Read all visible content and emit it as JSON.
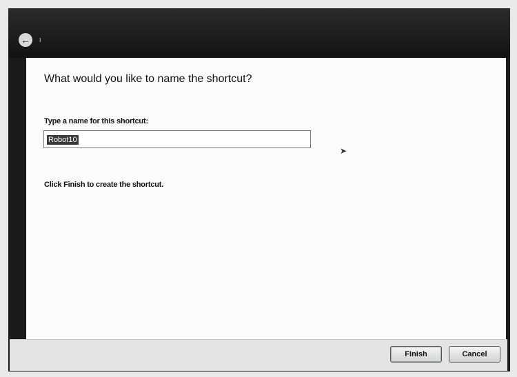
{
  "window": {
    "back_icon": "back-arrow-icon",
    "title_glyph": "ι"
  },
  "wizard": {
    "heading": "What would you like to name the shortcut?",
    "field_label": "Type a name for this shortcut:",
    "name_value": "Robot10",
    "finish_note": "Click Finish to create the shortcut."
  },
  "buttons": {
    "finish": "Finish",
    "cancel": "Cancel"
  }
}
